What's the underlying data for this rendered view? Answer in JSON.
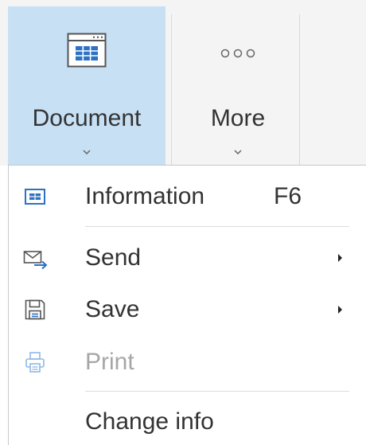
{
  "ribbon": {
    "document_label": "Document",
    "more_label": "More"
  },
  "menu": {
    "information": {
      "label": "Information",
      "shortcut": "F6"
    },
    "send": {
      "label": "Send"
    },
    "save": {
      "label": "Save"
    },
    "print": {
      "label": "Print",
      "disabled": true
    },
    "change_info": {
      "label": "Change info"
    }
  },
  "colors": {
    "active_tab": "#c7e0f4",
    "icon_blue": "#2b72c4",
    "disabled_text": "#a6a6a6"
  },
  "icons": [
    "document-icon",
    "more-icon",
    "chevron-down-icon",
    "information-icon",
    "send-icon",
    "save-icon",
    "print-icon",
    "submenu-arrow-icon"
  ]
}
